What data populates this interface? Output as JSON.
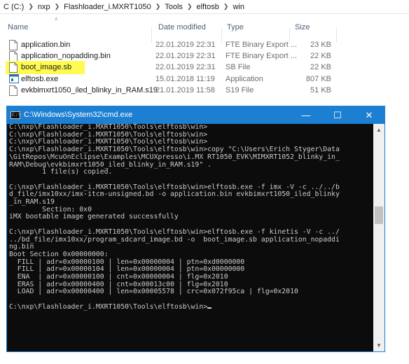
{
  "breadcrumb": [
    "C (C:)",
    "nxp",
    "Flashloader_i.MXRT1050",
    "Tools",
    "elftosb",
    "win"
  ],
  "columns": {
    "name": "Name",
    "date": "Date modified",
    "type": "Type",
    "size": "Size"
  },
  "files": [
    {
      "name": "application.bin",
      "date": "22.01.2019 22:31",
      "type": "FTE Binary Export ...",
      "size": "23 KB",
      "icon": "file-icon"
    },
    {
      "name": "application_nopadding.bin",
      "date": "22.01.2019 22:31",
      "type": "FTE Binary Export ...",
      "size": "22 KB",
      "icon": "file-icon"
    },
    {
      "name": "boot_image.sb",
      "date": "22.01.2019 22:31",
      "type": "SB File",
      "size": "22 KB",
      "icon": "file-icon"
    },
    {
      "name": "elftosb.exe",
      "date": "15.01.2018 11:19",
      "type": "Application",
      "size": "807 KB",
      "icon": "application-icon"
    },
    {
      "name": "evkbimxrt1050_iled_blinky_in_RAM.s19",
      "date": "21.01.2019 11:58",
      "type": "S19 File",
      "size": "51 KB",
      "icon": "file-icon"
    }
  ],
  "cmd": {
    "title": "C:\\Windows\\System32\\cmd.exe",
    "icon_label": "C:\\",
    "lines": [
      "C:\\nxp\\Flashloader_i.MXRT1050\\Tools\\elftosb\\win>",
      "C:\\nxp\\Flashloader_i.MXRT1050\\Tools\\elftosb\\win>",
      "C:\\nxp\\Flashloader_i.MXRT1050\\Tools\\elftosb\\win>",
      "C:\\nxp\\Flashloader_i.MXRT1050\\Tools\\elftosb\\win>copy \"C:\\Users\\Erich Styger\\Data",
      "\\GitRepos\\McuOnEclipse\\Examples\\MCUXpresso\\i.MX RT1050_EVK\\MIMXRT1052_blinky_in_",
      "RAM\\Debug\\evkbimxrt1050_iled_blinky_in_RAM.s19\" .",
      "        1 file(s) copied.",
      "",
      "C:\\nxp\\Flashloader_i.MXRT1050\\Tools\\elftosb\\win>elftosb.exe -f imx -V -c ../../b",
      "d_file/imx10xx/imx-itcm-unsigned.bd -o application.bin evkbimxrt1050_iled_blinky",
      "_in_RAM.s19",
      "        Section: 0x0",
      "iMX bootable image generated successfully",
      "",
      "C:\\nxp\\Flashloader_i.MXRT1050\\Tools\\elftosb\\win>elftosb.exe -f kinetis -V -c ../",
      "../bd_file/imx10xx/program_sdcard_image.bd -o  boot_image.sb application_nopaddi",
      "ng.bin",
      "Boot Section 0x00000000:",
      "  FILL | adr=0x00000100 | len=0x00000004 | ptn=0xd0000000",
      "  FILL | adr=0x00000104 | len=0x00000004 | ptn=0x00000000",
      "  ENA  | adr=0x00000100 | cnt=0x00000004 | flg=0x2010",
      "  ERAS | adr=0x00000400 | cnt=0x00013c00 | flg=0x2010",
      "  LOAD | adr=0x00000400 | len=0x00005578 | crc=0x072f95ca | flg=0x2010",
      "",
      "C:\\nxp\\Flashloader_i.MXRT1050\\Tools\\elftosb\\win>"
    ]
  }
}
